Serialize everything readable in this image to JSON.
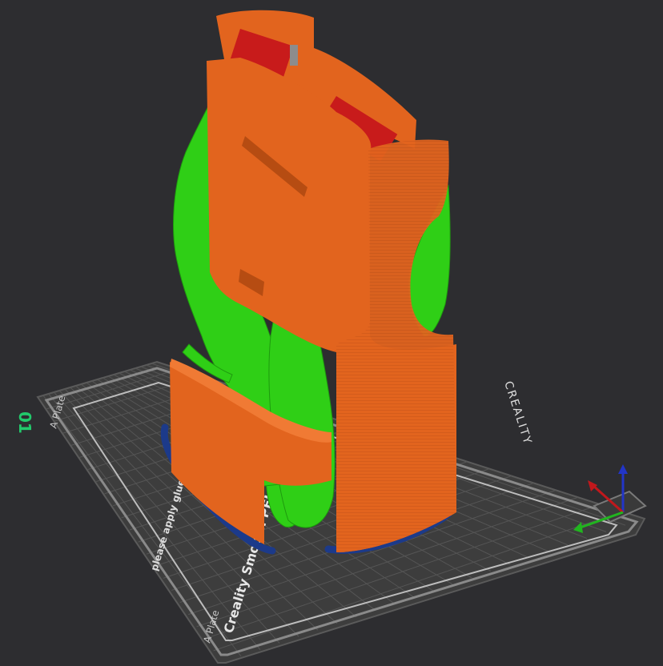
{
  "plate": {
    "number": "01",
    "label_top": "A Plate",
    "label_bottom": "A Plate",
    "brand": "CREALITY",
    "product": "Creality Smooth PEI Plate",
    "notice": "please apply glue before print"
  },
  "colors": {
    "background": "#2d2d30",
    "plate": "#3d3d3d",
    "grid": "#4f4f4f",
    "model_wall": "#e2641e",
    "support": "#2fcf16",
    "brim": "#1c3a8a",
    "plate_number": "#22c96b",
    "axis_x": "#c0181c",
    "axis_y": "#21b51f",
    "axis_z": "#2235c8"
  },
  "axes": {
    "x": "x-axis",
    "y": "y-axis",
    "z": "z-axis"
  }
}
